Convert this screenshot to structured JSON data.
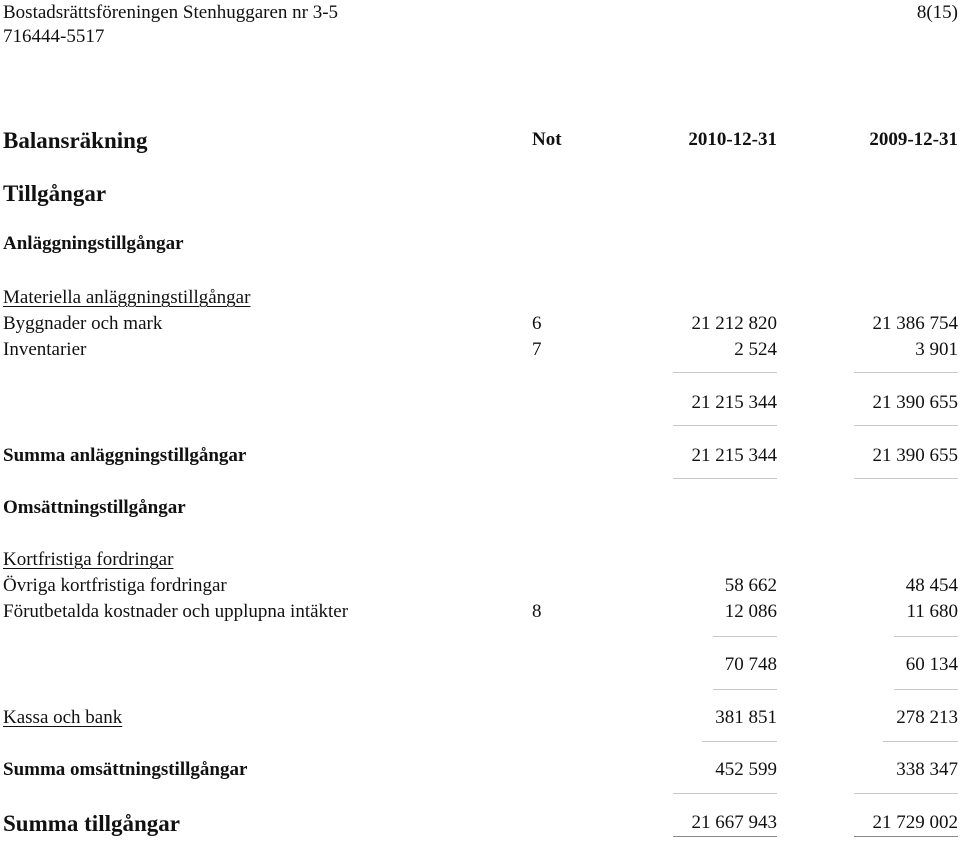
{
  "header": {
    "organization": "Bostadsrättsföreningen Stenhuggaren nr 3-5",
    "org_number": "716444-5517",
    "page": "8(15)"
  },
  "statement": {
    "title": "Balansräkning",
    "col_note": "Not",
    "col_current": "2010-12-31",
    "col_previous": "2009-12-31"
  },
  "assets": {
    "heading": "Tillgångar",
    "fixed": {
      "heading": "Anläggningstillgångar",
      "tangible_heading": "Materiella anläggningstillgångar",
      "rows": [
        {
          "label": "Byggnader och mark",
          "note": "6",
          "current": "21 212 820",
          "previous": "21 386 754"
        },
        {
          "label": "Inventarier",
          "note": "7",
          "current": "2 524",
          "previous": "3 901"
        }
      ],
      "subtotal": {
        "current": "21 215 344",
        "previous": "21 390 655"
      },
      "total": {
        "label": "Summa anläggningstillgångar",
        "current": "21 215 344",
        "previous": "21 390 655"
      }
    },
    "current": {
      "heading": "Omsättningstillgångar",
      "receivables_heading": "Kortfristiga fordringar",
      "rows": [
        {
          "label": "Övriga kortfristiga fordringar",
          "note": "",
          "current": "58 662",
          "previous": "48 454"
        },
        {
          "label": "Förutbetalda kostnader och upplupna intäkter",
          "note": "8",
          "current": "12 086",
          "previous": "11 680"
        }
      ],
      "subtotal": {
        "current": "70 748",
        "previous": "60 134"
      },
      "cash": {
        "label": "Kassa och bank",
        "current": "381 851",
        "previous": "278 213"
      },
      "total": {
        "label": "Summa omsättningstillgångar",
        "current": "452 599",
        "previous": "338 347"
      }
    },
    "grand_total": {
      "label": "Summa tillgångar",
      "current": "21 667 943",
      "previous": "21 729 002"
    }
  }
}
